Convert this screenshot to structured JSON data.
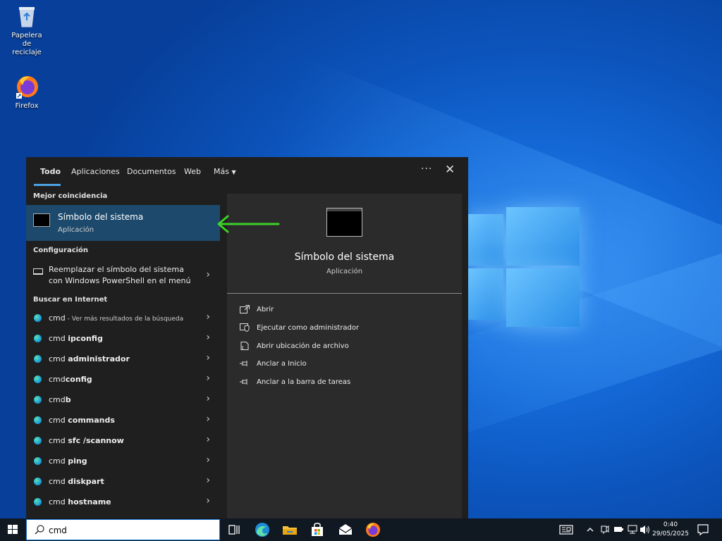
{
  "desktop": {
    "icons": [
      {
        "label": "Papelera de reciclaje"
      },
      {
        "label": "Firefox"
      }
    ]
  },
  "search_panel": {
    "tabs": [
      {
        "label": "Todo",
        "active": true
      },
      {
        "label": "Aplicaciones"
      },
      {
        "label": "Documentos"
      },
      {
        "label": "Web"
      },
      {
        "label": "Más"
      }
    ],
    "more_options_glyph": "···",
    "close_glyph": "✕",
    "best_match_header": "Mejor coincidencia",
    "best_match": {
      "title": "Símbolo del sistema",
      "subtitle": "Aplicación"
    },
    "settings_header": "Configuración",
    "settings_item": {
      "line1": "Reemplazar el símbolo del sistema",
      "line2": "con Windows PowerShell en el menú"
    },
    "web_header": "Buscar en Internet",
    "web_results": [
      {
        "prefix": "cmd",
        "bold": "",
        "suffix": " - Ver más resultados de la búsqueda"
      },
      {
        "prefix": "cmd ",
        "bold": "ipconfig",
        "suffix": ""
      },
      {
        "prefix": "cmd ",
        "bold": "administrador",
        "suffix": ""
      },
      {
        "prefix": "cmd",
        "bold": "config",
        "suffix": ""
      },
      {
        "prefix": "cmd",
        "bold": "b",
        "suffix": ""
      },
      {
        "prefix": "cmd ",
        "bold": "commands",
        "suffix": ""
      },
      {
        "prefix": "cmd ",
        "bold": "sfc /scannow",
        "suffix": ""
      },
      {
        "prefix": "cmd ",
        "bold": "ping",
        "suffix": ""
      },
      {
        "prefix": "cmd ",
        "bold": "diskpart",
        "suffix": ""
      },
      {
        "prefix": "cmd ",
        "bold": "hostname",
        "suffix": ""
      }
    ],
    "preview": {
      "title": "Símbolo del sistema",
      "subtitle": "Aplicación",
      "actions": [
        {
          "label": "Abrir",
          "icon": "open-icon"
        },
        {
          "label": "Ejecutar como administrador",
          "icon": "shield-icon"
        },
        {
          "label": "Abrir ubicación de archivo",
          "icon": "file-location-icon"
        },
        {
          "label": "Anclar a Inicio",
          "icon": "pin-icon"
        },
        {
          "label": "Anclar a la barra de tareas",
          "icon": "pin-icon"
        }
      ]
    }
  },
  "taskbar": {
    "search_value": "cmd",
    "clock": {
      "time": "0:40",
      "date": "29/05/2025"
    }
  },
  "colors": {
    "accent": "#1d4a6c",
    "arrow": "#3cd12b",
    "panel_bg": "#1f1f1f",
    "preview_bg": "#2b2b2b"
  }
}
